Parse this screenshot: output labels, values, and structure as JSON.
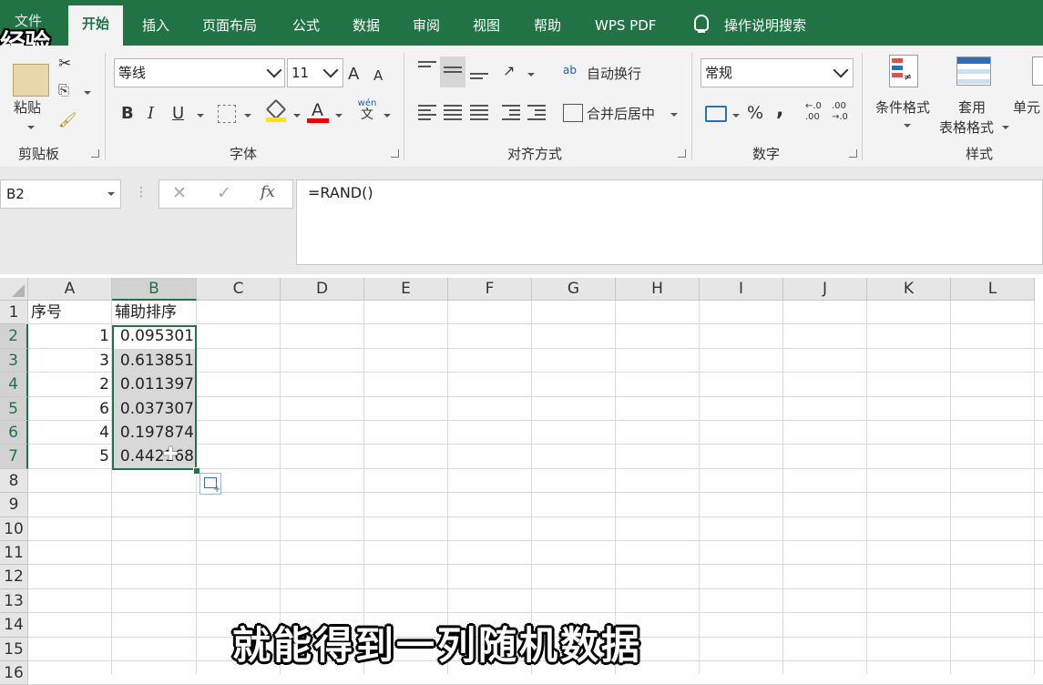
{
  "watermark": "经验",
  "tabs": [
    "文件",
    "开始",
    "插入",
    "页面布局",
    "公式",
    "数据",
    "审阅",
    "视图",
    "帮助",
    "WPS PDF",
    "操作说明搜索"
  ],
  "colors": {
    "accent": "#217346",
    "selection_fill": "#d8d8d8",
    "ribbon_bg": "#f3f3f3"
  },
  "ribbon": {
    "clipboard": {
      "paste_label": "粘贴",
      "group_label": "剪贴板"
    },
    "font": {
      "font_name": "等线",
      "font_size": "11",
      "grow_icon": "A",
      "shrink_icon": "A",
      "bold": "B",
      "italic": "I",
      "underline": "U",
      "phonetic_top": "wén",
      "phonetic_bottom": "文",
      "group_label": "字体"
    },
    "alignment": {
      "wrap_label": "自动换行",
      "merge_label": "合并后居中",
      "wrap_icon": "ab",
      "group_label": "对齐方式"
    },
    "number": {
      "format": "常规",
      "percent": "%",
      "comma": ",",
      "inc_decimal_top": "←.0",
      "inc_decimal_bottom": ".00",
      "dec_decimal_top": ".00",
      "dec_decimal_bottom": "→.0",
      "group_label": "数字"
    },
    "styles": {
      "conditional_label": "条件格式",
      "table_label_1": "套用",
      "table_label_2": "表格格式",
      "cell_label": "单元",
      "group_label": "样式"
    }
  },
  "formula_bar": {
    "name_box": "B2",
    "fx": "fx",
    "formula": "=RAND()"
  },
  "sheet": {
    "columns": [
      "A",
      "B",
      "C",
      "D",
      "E",
      "F",
      "G",
      "H",
      "I",
      "J",
      "K",
      "L"
    ],
    "rows": [
      "1",
      "2",
      "3",
      "4",
      "5",
      "6",
      "7",
      "8",
      "9",
      "10",
      "11",
      "12",
      "13",
      "14",
      "15",
      "16"
    ],
    "header_row": {
      "A": "序号",
      "B": "辅助排序"
    },
    "data_rows": [
      {
        "A": "1",
        "B": "0.095301"
      },
      {
        "A": "3",
        "B": "0.613851"
      },
      {
        "A": "2",
        "B": "0.011397"
      },
      {
        "A": "6",
        "B": "0.037307"
      },
      {
        "A": "4",
        "B": "0.197874"
      },
      {
        "A": "5",
        "B": "0.442168"
      }
    ]
  },
  "subtitle": "就能得到一列随机数据"
}
